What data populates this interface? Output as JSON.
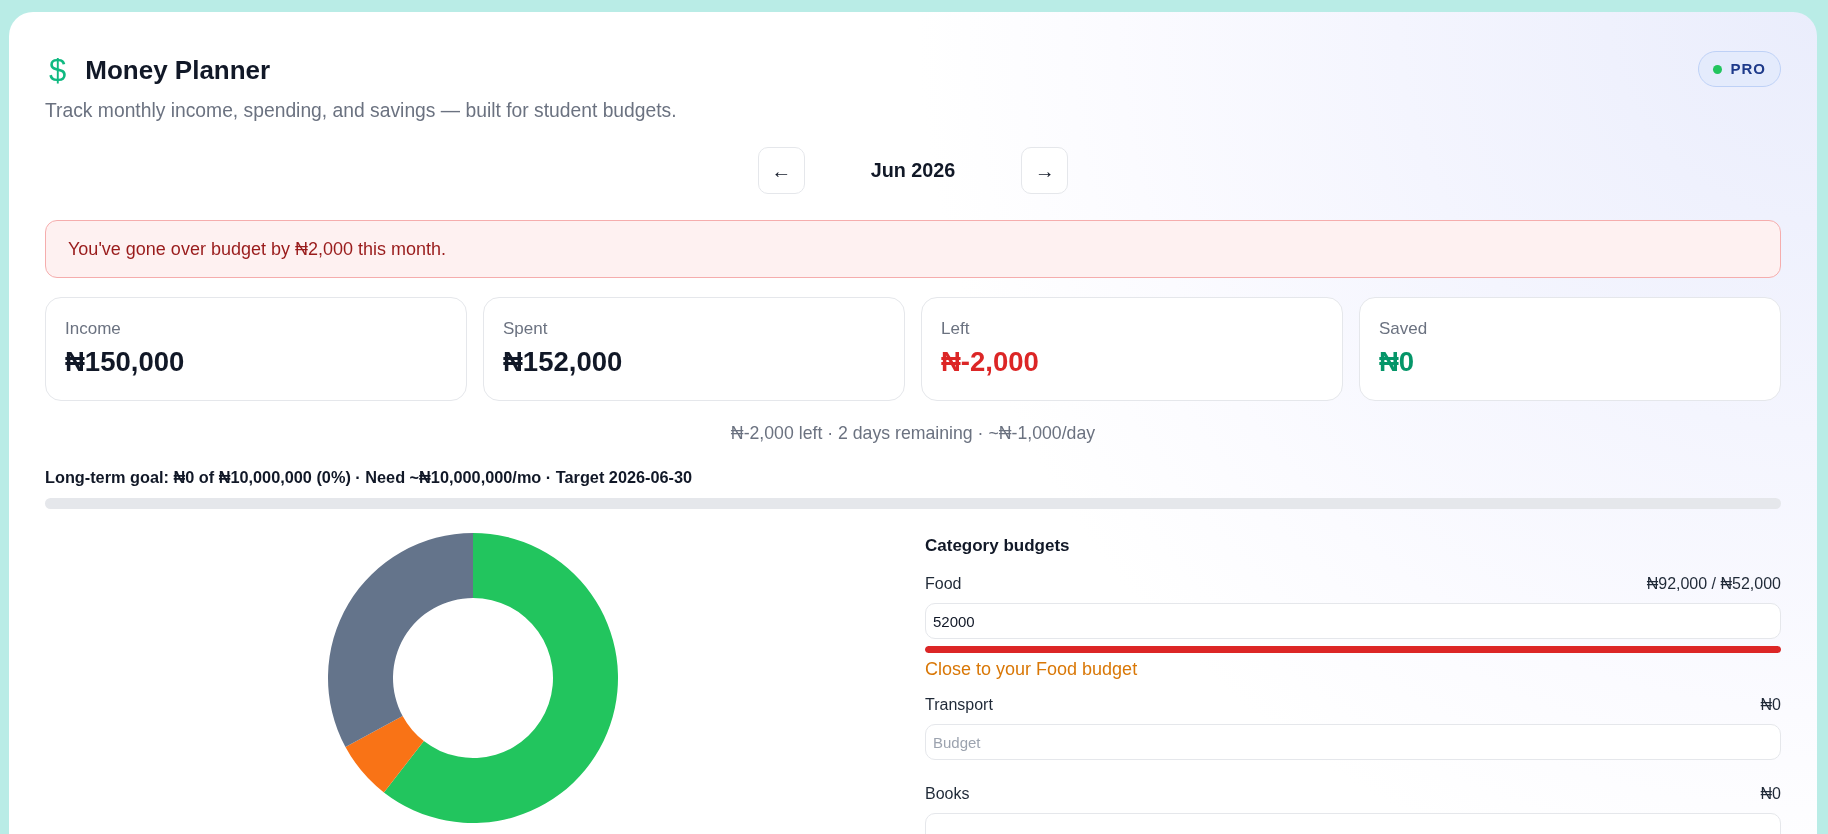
{
  "header": {
    "logo": "$",
    "title": "Money Planner",
    "subtitle": "Track monthly income, spending, and savings — built for student budgets.",
    "badge": "PRO"
  },
  "month_nav": {
    "prev": "←",
    "month": "Jun 2026",
    "next": "→"
  },
  "alert": {
    "text": "You've gone over budget by ₦2,000 this month."
  },
  "stats": [
    {
      "label": "Income",
      "value": "₦150,000",
      "color": "#111827"
    },
    {
      "label": "Spent",
      "value": "₦152,000",
      "color": "#111827"
    },
    {
      "label": "Left",
      "value": "₦-2,000",
      "color": "#dc2626"
    },
    {
      "label": "Saved",
      "value": "₦0",
      "color": "#059669"
    }
  ],
  "summary": "₦-2,000 left · 2 days remaining · ~₦-1,000/day",
  "goal": {
    "text": "Long-term goal: ₦0 of ₦10,000,000 (0%) · Need ~₦10,000,000/mo · Target 2026-06-30",
    "level": 0
  },
  "category_budgets": {
    "title": "Category budgets",
    "items": [
      {
        "name": "Food",
        "amount": "₦92,000 / ₦52,000",
        "value": "52000",
        "level": 1,
        "over_budget": true,
        "warning": "Close to your Food budget"
      },
      {
        "name": "Transport",
        "amount": "₦0",
        "placeholder": "Budget"
      },
      {
        "name": "Books",
        "amount": "₦0"
      }
    ]
  }
}
